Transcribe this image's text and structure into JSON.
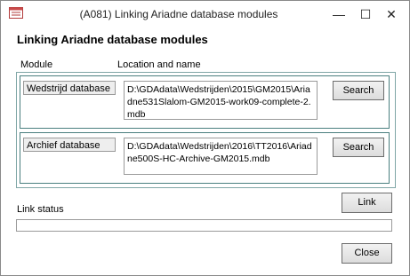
{
  "window": {
    "title": "(A081) Linking Ariadne database modules",
    "minimize_glyph": "—",
    "maximize_glyph": "☐",
    "close_glyph": "✕"
  },
  "heading": "Linking Ariadne database modules",
  "columns": {
    "module": "Module",
    "location": "Location and name"
  },
  "modules": [
    {
      "label": "Wedstrijd database",
      "path": "D:\\GDAdata\\Wedstrijden\\2015\\GM2015\\Ariadne531Slalom-GM2015-work09-complete-2.mdb",
      "button": "Search"
    },
    {
      "label": "Archief database",
      "path": "D:\\GDAdata\\Wedstrijden\\2016\\TT2016\\Ariadne500S-HC-Archive-GM2015.mdb",
      "button": "Search"
    }
  ],
  "link_button": "Link",
  "link_status_label": "Link status",
  "link_status_value": "",
  "close_button": "Close",
  "icons": {
    "app": "access-form-icon"
  }
}
